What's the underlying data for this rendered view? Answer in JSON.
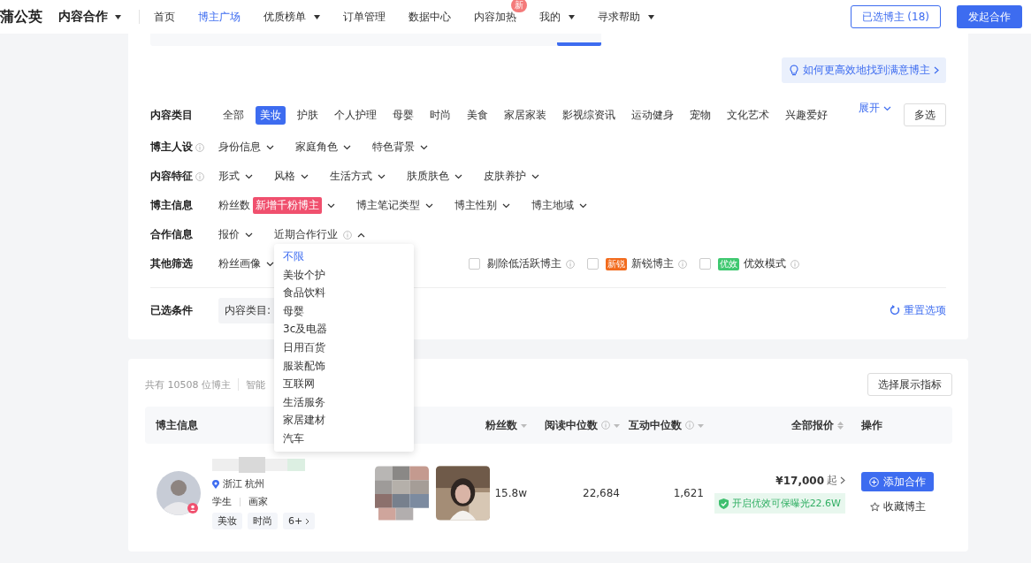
{
  "nav": {
    "logo": "蒲公英",
    "menu": "内容合作",
    "items": [
      {
        "label": "首页",
        "selected": false,
        "caret": false
      },
      {
        "label": "博主广场",
        "selected": true,
        "caret": false
      },
      {
        "label": "优质榜单",
        "selected": false,
        "caret": true
      },
      {
        "label": "订单管理",
        "selected": false,
        "caret": false
      },
      {
        "label": "数据中心",
        "selected": false,
        "caret": false
      },
      {
        "label": "内容加热",
        "selected": false,
        "caret": false,
        "badge": "新"
      },
      {
        "label": "我的",
        "selected": false,
        "caret": true
      },
      {
        "label": "寻求帮助",
        "selected": false,
        "caret": true
      }
    ],
    "selected_button": "已选博主 (18)",
    "primary_button": "发起合作"
  },
  "hint_link": "如何更高效地找到满意博主",
  "filters": [
    {
      "kind": "tags",
      "label": "内容类目",
      "info": false,
      "options": [
        {
          "label": "全部",
          "selected": false
        },
        {
          "label": "美妆",
          "selected": true
        },
        {
          "label": "护肤",
          "selected": false
        },
        {
          "label": "个人护理",
          "selected": false
        },
        {
          "label": "母婴",
          "selected": false
        },
        {
          "label": "时尚",
          "selected": false
        },
        {
          "label": "美食",
          "selected": false
        },
        {
          "label": "家居家装",
          "selected": false
        },
        {
          "label": "影视综资讯",
          "selected": false
        },
        {
          "label": "运动健身",
          "selected": false
        },
        {
          "label": "宠物",
          "selected": false
        },
        {
          "label": "文化艺术",
          "selected": false
        },
        {
          "label": "兴趣爱好",
          "selected": false
        }
      ],
      "expand": "展开",
      "multi": "多选"
    },
    {
      "kind": "dropdowns",
      "label": "博主人设",
      "info": true,
      "options": [
        {
          "label": "身份信息",
          "expanded": false
        },
        {
          "label": "家庭角色",
          "expanded": false
        },
        {
          "label": "特色背景",
          "expanded": false
        }
      ]
    },
    {
      "kind": "dropdowns",
      "label": "内容特征",
      "info": true,
      "options": [
        {
          "label": "形式",
          "expanded": false
        },
        {
          "label": "风格",
          "expanded": false
        },
        {
          "label": "生活方式",
          "expanded": false
        },
        {
          "label": "肤质肤色",
          "expanded": false
        },
        {
          "label": "皮肤养护",
          "expanded": false
        }
      ]
    },
    {
      "kind": "dropdowns",
      "label": "博主信息",
      "info": false,
      "options": [
        {
          "label": "粉丝数",
          "badge": "新增千粉博主",
          "expanded": false
        },
        {
          "label": "博主笔记类型",
          "expanded": false
        },
        {
          "label": "博主性别",
          "expanded": false
        },
        {
          "label": "博主地域",
          "expanded": false
        }
      ]
    },
    {
      "kind": "dropdowns",
      "label": "合作信息",
      "info": false,
      "options": [
        {
          "label": "报价",
          "expanded": false
        },
        {
          "label": "近期合作行业",
          "info": true,
          "expanded": true
        }
      ]
    },
    {
      "kind": "other",
      "label": "其他筛选",
      "info": false,
      "options": [
        {
          "label": "粉丝画像",
          "expanded": false
        }
      ],
      "checks": [
        {
          "label": "剔除低活跃博主",
          "checked": false
        },
        {
          "label": "新锐博主",
          "checked": false,
          "tag": "新锐",
          "color": "#f26b1d"
        },
        {
          "label": "优效模式",
          "checked": false,
          "tag": "优效",
          "color": "#3fc870"
        }
      ]
    }
  ],
  "selected_conditions": {
    "label": "已选条件",
    "chip": "内容类目:",
    "reset": "重置选项"
  },
  "industry_menu": [
    {
      "label": "不限",
      "selected": true
    },
    {
      "label": "美妆个护",
      "selected": false
    },
    {
      "label": "食品饮料",
      "selected": false
    },
    {
      "label": "母婴",
      "selected": false
    },
    {
      "label": "3c及电器",
      "selected": false
    },
    {
      "label": "日用百货",
      "selected": false
    },
    {
      "label": "服装配饰",
      "selected": false
    },
    {
      "label": "互联网",
      "selected": false
    },
    {
      "label": "生活服务",
      "selected": false
    },
    {
      "label": "家居建材",
      "selected": false
    },
    {
      "label": "汽车",
      "selected": false
    }
  ],
  "results": {
    "count": "共有 10508 位博主",
    "sort": "智能",
    "metrics_button": "选择展示指标",
    "columns": [
      {
        "label": "博主信息",
        "kind": "plain"
      },
      {
        "label": "粉丝数",
        "kind": "sort"
      },
      {
        "label": "阅读中位数",
        "kind": "info-sort"
      },
      {
        "label": "互动中位数",
        "kind": "info-sort"
      },
      {
        "label": "全部报价",
        "kind": "both-sort"
      },
      {
        "label": "操作",
        "kind": "plain"
      }
    ],
    "rows": [
      {
        "location": "浙江 杭州",
        "roles": [
          "学生",
          "画家"
        ],
        "tags": [
          "美妆",
          "时尚",
          "6+"
        ],
        "fans": "15.8w",
        "reads": "22,684",
        "interactions": "1,621",
        "price": "¥17,000",
        "price_suffix": "起",
        "promo": "开启优效可保曝光22.6W",
        "add_button": "添加合作",
        "favorite": "收藏博主"
      }
    ]
  }
}
